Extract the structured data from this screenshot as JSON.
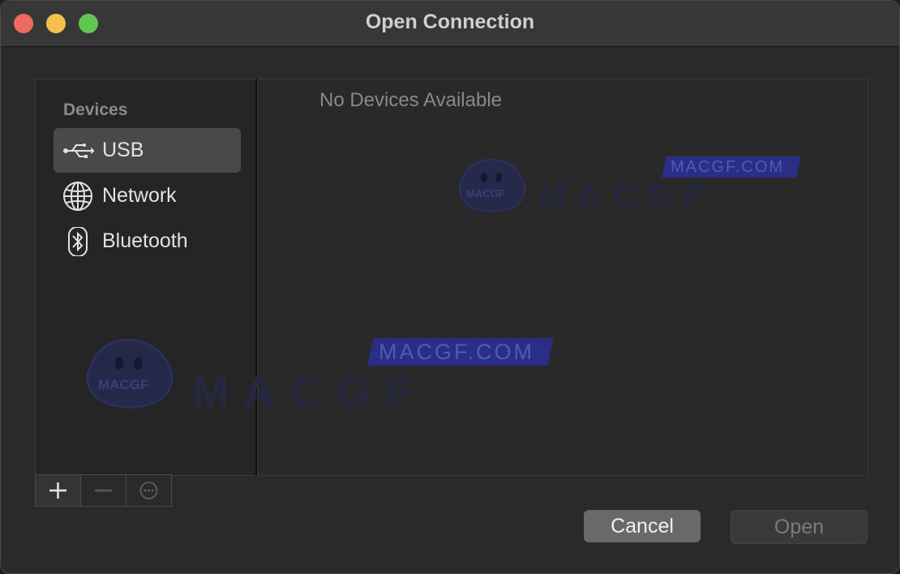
{
  "window": {
    "title": "Open Connection"
  },
  "sidebar": {
    "section_title": "Devices",
    "items": [
      {
        "label": "USB",
        "icon": "usb-icon",
        "selected": true
      },
      {
        "label": "Network",
        "icon": "globe-icon",
        "selected": false
      },
      {
        "label": "Bluetooth",
        "icon": "bluetooth-icon",
        "selected": false
      }
    ]
  },
  "content": {
    "empty_message": "No Devices Available"
  },
  "toolbar": {
    "add_icon": "plus-icon",
    "remove_icon": "minus-icon",
    "more_icon": "ellipsis-icon"
  },
  "buttons": {
    "cancel": "Cancel",
    "open": "Open"
  },
  "watermark": {
    "text": "MACGF.COM",
    "mascot_text": "MACGF"
  },
  "colors": {
    "selected_bg": "#4a494a",
    "accent_blue": "#2b2f8a"
  }
}
